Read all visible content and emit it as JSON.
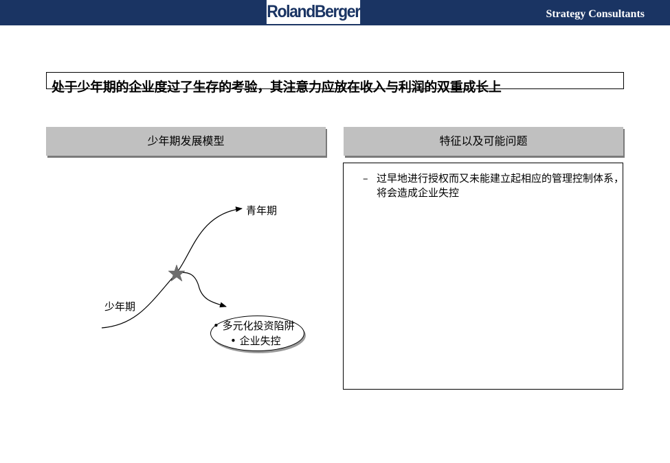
{
  "header": {
    "logo": "RolandBerger",
    "tagline": "Strategy Consultants"
  },
  "title": "处于少年期的企业度过了生存的考验，其注意力应放在收入与利润的双重成长上",
  "left_section": {
    "heading": "少年期发展模型",
    "labels": {
      "youth": "青年期",
      "juvenile": "少年期"
    },
    "risks": [
      "• 多元化投资陷阱",
      "• 企业失控"
    ]
  },
  "right_section": {
    "heading": "特征以及可能问题",
    "issues": [
      {
        "bullet": "–",
        "text": "过早地进行授权而又未能建立起相应的管理控制体系，将会造成企业失控"
      }
    ]
  },
  "colors": {
    "brand": "#1a3463",
    "header_fill": "#c0c0c0",
    "star": "#6e6e6e"
  }
}
